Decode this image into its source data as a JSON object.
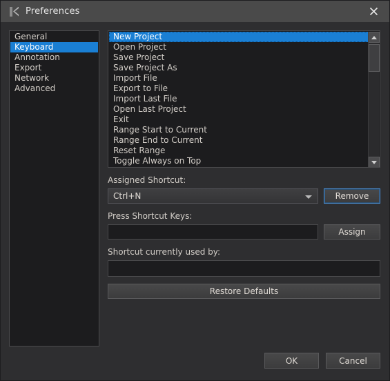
{
  "window": {
    "title": "Preferences",
    "app_icon": "k-logo-icon",
    "close_icon": "close-icon",
    "accent_color": "#1a7fd4",
    "background_color": "#2e2e30",
    "titlebar_color": "#4a4a4a"
  },
  "sidebar": {
    "items": [
      {
        "label": "General",
        "selected": false
      },
      {
        "label": "Keyboard",
        "selected": true
      },
      {
        "label": "Annotation",
        "selected": false
      },
      {
        "label": "Export",
        "selected": false
      },
      {
        "label": "Network",
        "selected": false
      },
      {
        "label": "Advanced",
        "selected": false
      }
    ]
  },
  "commands": {
    "items": [
      {
        "label": "New Project",
        "selected": true
      },
      {
        "label": "Open Project",
        "selected": false
      },
      {
        "label": "Save Project",
        "selected": false
      },
      {
        "label": "Save Project As",
        "selected": false
      },
      {
        "label": "Import File",
        "selected": false
      },
      {
        "label": "Export to File",
        "selected": false
      },
      {
        "label": "Import Last File",
        "selected": false
      },
      {
        "label": "Open Last Project",
        "selected": false
      },
      {
        "label": "Exit",
        "selected": false
      },
      {
        "label": "Range Start to Current",
        "selected": false
      },
      {
        "label": "Range End to Current",
        "selected": false
      },
      {
        "label": "Reset Range",
        "selected": false
      },
      {
        "label": "Toggle Always on Top",
        "selected": false
      }
    ],
    "scrollbar": {
      "up_icon": "scroll-up-arrow-icon",
      "down_icon": "scroll-down-arrow-icon"
    }
  },
  "form": {
    "assigned_shortcut_label": "Assigned Shortcut:",
    "assigned_shortcut_value": "Ctrl+N",
    "assigned_shortcut_options": [
      "Ctrl+N"
    ],
    "remove_label": "Remove",
    "press_shortcut_label": "Press Shortcut Keys:",
    "press_shortcut_value": "",
    "press_shortcut_placeholder": "",
    "assign_label": "Assign",
    "used_by_label": "Shortcut currently used by:",
    "used_by_value": "",
    "restore_defaults_label": "Restore Defaults"
  },
  "footer": {
    "ok_label": "OK",
    "cancel_label": "Cancel"
  }
}
